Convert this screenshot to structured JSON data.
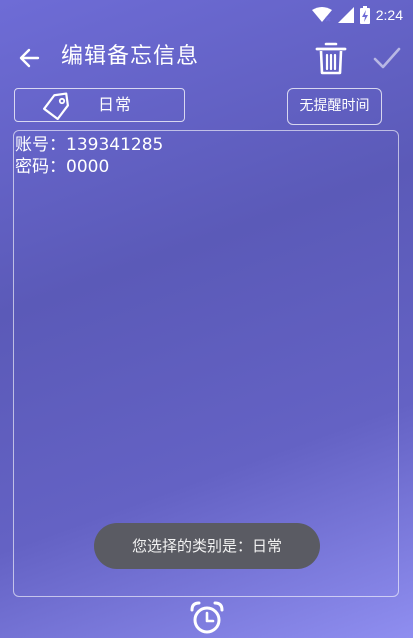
{
  "status_bar": {
    "time": "2:24",
    "icons": [
      "wifi-icon",
      "signal-icon",
      "battery-charging-icon"
    ]
  },
  "app_bar": {
    "title": "编辑备忘信息",
    "icons": [
      "back-arrow-icon",
      "trash-icon",
      "check-icon"
    ]
  },
  "category": {
    "label": "日常",
    "icon": "tag-icon"
  },
  "reminder": {
    "label": "无提醒时间"
  },
  "memo": {
    "lines": [
      "账号：139341285",
      "密码：0000"
    ]
  },
  "toast": {
    "message": "您选择的类别是：日常"
  },
  "bottom": {
    "icon": "alarm-clock-icon"
  },
  "colors": {
    "background_top": "#6e6cd6",
    "background_mid": "#5b5ab8",
    "background_bottom": "#8f8ef0",
    "toast_bg": "#5a5b63",
    "foreground": "#ffffff"
  }
}
